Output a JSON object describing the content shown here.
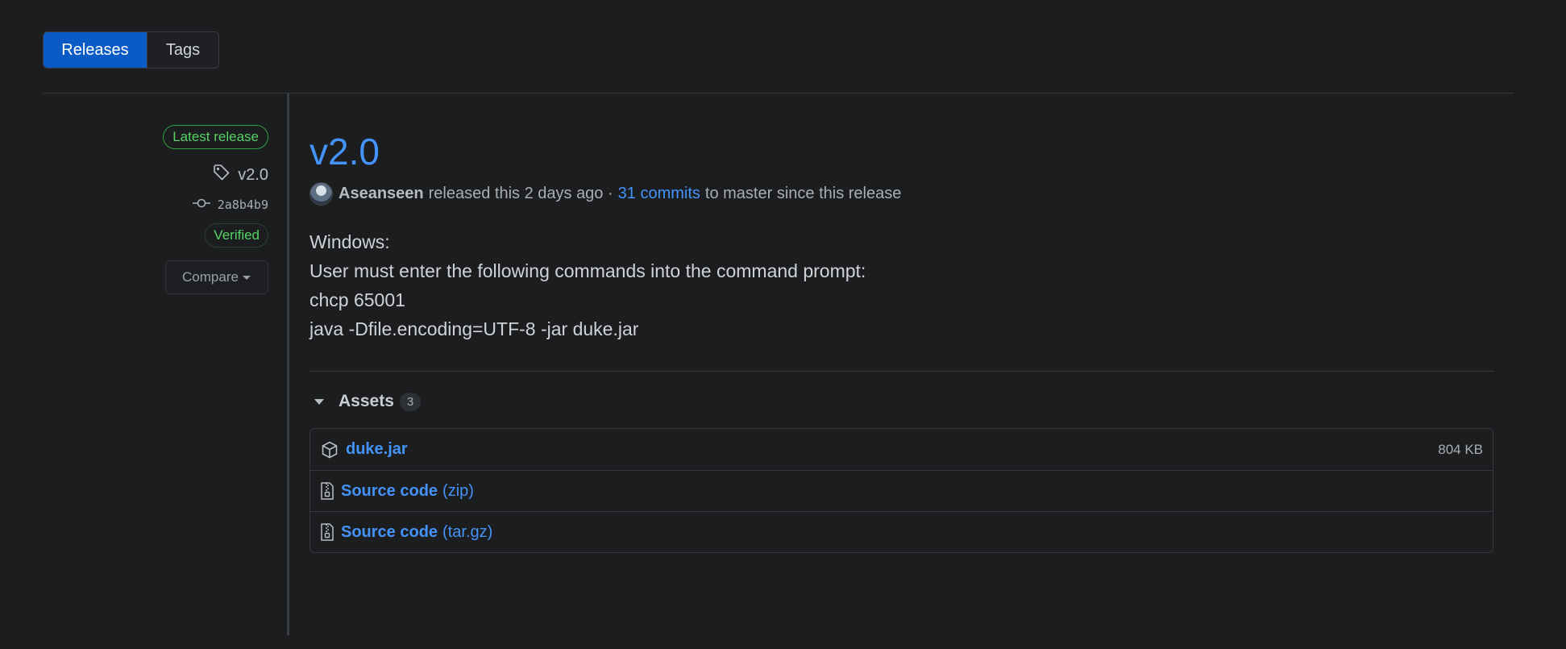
{
  "tabs": [
    {
      "label": "Releases",
      "selected": true
    },
    {
      "label": "Tags",
      "selected": false
    }
  ],
  "sidebar": {
    "latest_badge": "Latest release",
    "tag": "v2.0",
    "commit": "2a8b4b9",
    "verified": "Verified",
    "compare": "Compare"
  },
  "release": {
    "title": "v2.0",
    "author": "Aseanseen",
    "released_text": "released this 2 days ago ·",
    "commits_link": "31 commits",
    "commits_suffix": "to master since this release",
    "body_lines": [
      "Windows:",
      "User must enter the following commands into the command prompt:",
      "chcp 65001",
      "java -Dfile.encoding=UTF-8 -jar duke.jar"
    ]
  },
  "assets": {
    "label": "Assets",
    "count": "3",
    "items": [
      {
        "name": "duke.jar",
        "suffix": "",
        "size": "804 KB",
        "icon": "package-icon"
      },
      {
        "name": "Source code",
        "suffix": "(zip)",
        "size": "",
        "icon": "file-zip-icon"
      },
      {
        "name": "Source code",
        "suffix": "(tar.gz)",
        "size": "",
        "icon": "file-zip-icon"
      }
    ]
  },
  "colors": {
    "background": "#1c1d1f",
    "accent": "#4493f8",
    "selected_tab": "#0b5bc6",
    "success": "#56d364"
  }
}
